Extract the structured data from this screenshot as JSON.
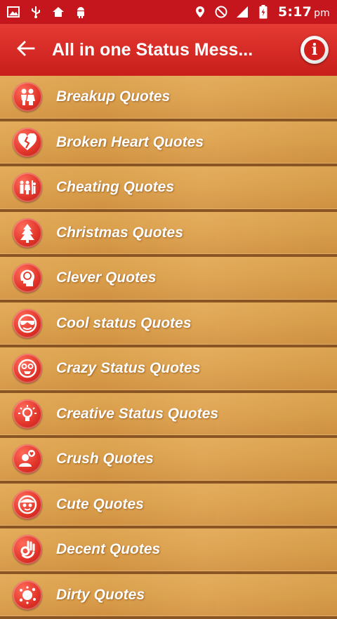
{
  "status_bar": {
    "time": "5:17",
    "ampm": "pm",
    "left_icons": [
      "image-icon",
      "usb-icon",
      "home-icon",
      "android-icon"
    ],
    "right_icons": [
      "location-icon",
      "do-not-disturb-icon",
      "signal-icon",
      "battery-charging-icon"
    ]
  },
  "app_bar": {
    "title": "All in one Status Mess...",
    "back_icon": "arrow-left-icon",
    "info_label": "i"
  },
  "items": [
    {
      "label": "Breakup Quotes",
      "icon": "couple-icon"
    },
    {
      "label": "Broken Heart Quotes",
      "icon": "broken-heart-icon"
    },
    {
      "label": "Cheating Quotes",
      "icon": "cheating-people-icon"
    },
    {
      "label": "Christmas Quotes",
      "icon": "christmas-tree-icon"
    },
    {
      "label": "Clever Quotes",
      "icon": "brain-head-icon"
    },
    {
      "label": "Cool status Quotes",
      "icon": "cool-face-icon"
    },
    {
      "label": "Crazy Status Quotes",
      "icon": "crazy-face-icon"
    },
    {
      "label": "Creative Status Quotes",
      "icon": "lightbulb-icon"
    },
    {
      "label": "Crush Quotes",
      "icon": "crush-person-icon"
    },
    {
      "label": "Cute Quotes",
      "icon": "cute-face-icon"
    },
    {
      "label": "Decent Quotes",
      "icon": "ok-hand-icon"
    },
    {
      "label": "Dirty Quotes",
      "icon": "splash-icon"
    }
  ]
}
